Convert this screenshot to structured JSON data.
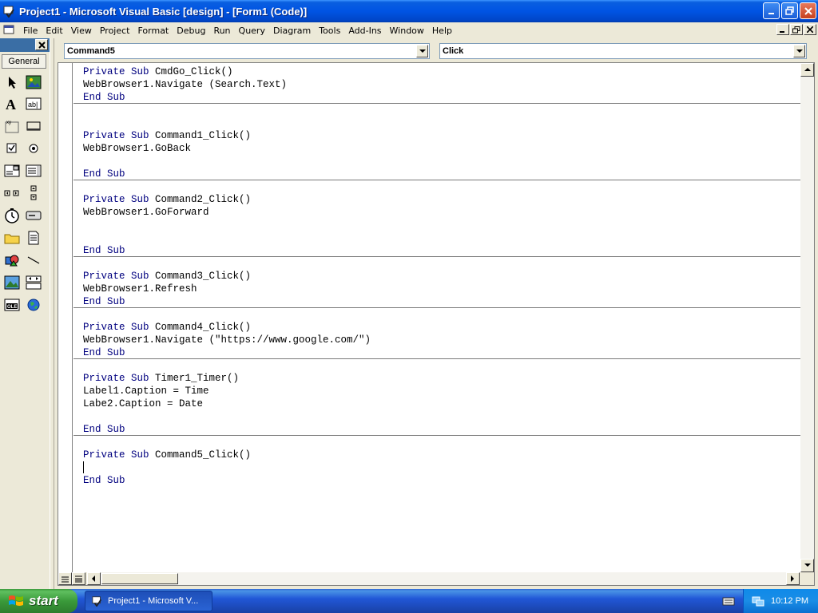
{
  "window": {
    "title": "Project1 - Microsoft Visual Basic [design] - [Form1 (Code)]",
    "icon": "vb-project-icon"
  },
  "menu": [
    {
      "label": "File"
    },
    {
      "label": "Edit"
    },
    {
      "label": "View"
    },
    {
      "label": "Project"
    },
    {
      "label": "Format"
    },
    {
      "label": "Debug"
    },
    {
      "label": "Run"
    },
    {
      "label": "Query"
    },
    {
      "label": "Diagram"
    },
    {
      "label": "Tools"
    },
    {
      "label": "Add-Ins"
    },
    {
      "label": "Window"
    },
    {
      "label": "Help"
    }
  ],
  "toolbox": {
    "tab_label": "General",
    "tools": [
      "pointer-icon",
      "picturebox-icon",
      "label-icon",
      "textbox-icon",
      "frame-icon",
      "commandbutton-icon",
      "checkbox-icon",
      "optionbutton-icon",
      "combobox-icon",
      "listbox-icon",
      "hscrollbar-icon",
      "vscrollbar-icon",
      "timer-icon",
      "drivelistbox-icon",
      "dirlistbox-icon",
      "filelistbox-icon",
      "shape-icon",
      "line-icon",
      "image-icon",
      "data-icon",
      "ole-icon",
      "webbrowser-icon"
    ]
  },
  "code_window": {
    "object_combo": "Command5",
    "procedure_combo": "Click",
    "lines": [
      "Private Sub CmdGo_Click()",
      "WebBrowser1.Navigate (Search.Text)",
      "End Sub",
      "",
      "",
      "Private Sub Command1_Click()",
      "WebBrowser1.GoBack",
      "",
      "End Sub",
      "",
      "Private Sub Command2_Click()",
      "WebBrowser1.GoForward",
      "",
      "",
      "End Sub",
      "",
      "Private Sub Command3_Click()",
      "WebBrowser1.Refresh",
      "End Sub",
      "",
      "Private Sub Command4_Click()",
      "WebBrowser1.Navigate (\"https://www.google.com/\")",
      "End Sub",
      "",
      "Private Sub Timer1_Timer()",
      "Label1.Caption = Time",
      "Labe2.Caption = Date",
      "",
      "End Sub",
      "",
      "Private Sub Command5_Click()",
      "",
      "End Sub"
    ]
  },
  "taskbar": {
    "start_label": "start",
    "task_label": "Project1 - Microsoft V...",
    "clock": "10:12 PM"
  }
}
